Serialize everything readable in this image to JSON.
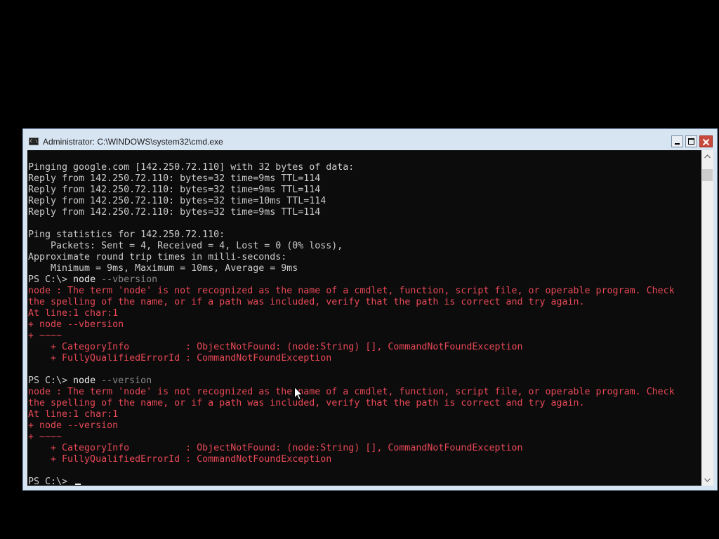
{
  "window": {
    "title": "Administrator: C:\\WINDOWS\\system32\\cmd.exe",
    "icon_glyph": "C:\\"
  },
  "console": {
    "lines": [
      {
        "text": "Pinging google.com [142.250.72.110] with 32 bytes of data:",
        "kind": "normal"
      },
      {
        "text": "Reply from 142.250.72.110: bytes=32 time=9ms TTL=114",
        "kind": "normal"
      },
      {
        "text": "Reply from 142.250.72.110: bytes=32 time=9ms TTL=114",
        "kind": "normal"
      },
      {
        "text": "Reply from 142.250.72.110: bytes=32 time=10ms TTL=114",
        "kind": "normal"
      },
      {
        "text": "Reply from 142.250.72.110: bytes=32 time=9ms TTL=114",
        "kind": "normal"
      },
      {
        "text": "",
        "kind": "normal"
      },
      {
        "text": "Ping statistics for 142.250.72.110:",
        "kind": "normal"
      },
      {
        "text": "    Packets: Sent = 4, Received = 4, Lost = 0 (0% loss),",
        "kind": "normal"
      },
      {
        "text": "Approximate round trip times in milli-seconds:",
        "kind": "normal"
      },
      {
        "text": "    Minimum = 9ms, Maximum = 10ms, Average = 9ms",
        "kind": "normal"
      },
      {
        "kind": "prompt",
        "prompt": "PS C:\\> ",
        "command": "node",
        "args": " --vbersion"
      },
      {
        "text": "node : The term 'node' is not recognized as the name of a cmdlet, function, script file, or operable program. Check",
        "kind": "error"
      },
      {
        "text": "the spelling of the name, or if a path was included, verify that the path is correct and try again.",
        "kind": "error"
      },
      {
        "text": "At line:1 char:1",
        "kind": "error"
      },
      {
        "text": "+ node --vbersion",
        "kind": "error"
      },
      {
        "text": "+ ~~~~",
        "kind": "error"
      },
      {
        "text": "    + CategoryInfo          : ObjectNotFound: (node:String) [], CommandNotFoundException",
        "kind": "error"
      },
      {
        "text": "    + FullyQualifiedErrorId : CommandNotFoundException",
        "kind": "error"
      },
      {
        "text": "",
        "kind": "normal"
      },
      {
        "kind": "prompt",
        "prompt": "PS C:\\> ",
        "command": "node",
        "args": " --version"
      },
      {
        "text": "node : The term 'node' is not recognized as the name of a cmdlet, function, script file, or operable program. Check",
        "kind": "error"
      },
      {
        "text": "the spelling of the name, or if a path was included, verify that the path is correct and try again.",
        "kind": "error"
      },
      {
        "text": "At line:1 char:1",
        "kind": "error"
      },
      {
        "text": "+ node --version",
        "kind": "error"
      },
      {
        "text": "+ ~~~~",
        "kind": "error"
      },
      {
        "text": "    + CategoryInfo          : ObjectNotFound: (node:String) [], CommandNotFoundException",
        "kind": "error"
      },
      {
        "text": "    + FullyQualifiedErrorId : CommandNotFoundException",
        "kind": "error"
      },
      {
        "text": "",
        "kind": "normal"
      },
      {
        "kind": "prompt",
        "prompt": "PS C:\\> ",
        "command": "",
        "args": "",
        "cursor": true
      }
    ]
  },
  "colors": {
    "background": "#0c0c0c",
    "text": "#cccccc",
    "error": "#e74856",
    "command": "#f2f2f2",
    "argument": "#8a8a8a",
    "titlebar": "#d7e4f2",
    "close_button": "#c7483c"
  },
  "icons": {
    "window_icon": "console-icon",
    "minimize": "minimize-icon",
    "maximize": "maximize-icon",
    "close": "close-icon",
    "scroll_up": "chevron-up-icon",
    "scroll_down": "chevron-down-icon",
    "pointer": "mouse-pointer-icon"
  }
}
